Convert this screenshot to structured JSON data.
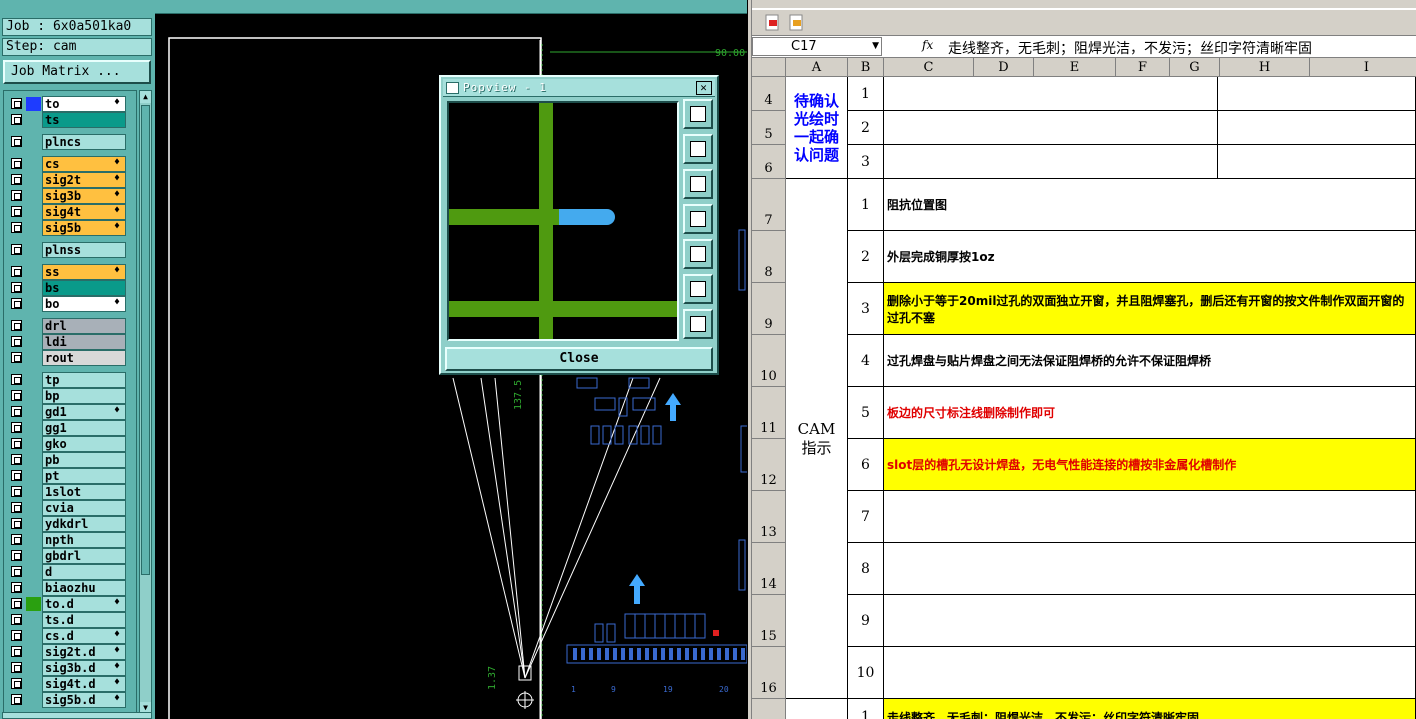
{
  "cam": {
    "job_label": "Job : 6x0a501ka0",
    "step_label": "Step: cam",
    "job_matrix_button": "Job Matrix ...",
    "layers": [
      {
        "name": "to",
        "swatch": "#1e3cff",
        "fill": "#ffffff",
        "flame": true
      },
      {
        "name": "ts",
        "swatch": "",
        "fill": "#0a9a8a",
        "flame": false
      },
      {
        "name": "plncs",
        "swatch": "",
        "fill": "#a6e0dc",
        "flame": false
      },
      {
        "name": "cs",
        "swatch": "",
        "fill": "#ffc040",
        "flame": true
      },
      {
        "name": "sig2t",
        "swatch": "",
        "fill": "#ffc040",
        "flame": true
      },
      {
        "name": "sig3b",
        "swatch": "",
        "fill": "#ffc040",
        "flame": true
      },
      {
        "name": "sig4t",
        "swatch": "",
        "fill": "#ffc040",
        "flame": true
      },
      {
        "name": "sig5b",
        "swatch": "",
        "fill": "#ffc040",
        "flame": true
      },
      {
        "name": "plnss",
        "swatch": "",
        "fill": "#a6e0dc",
        "flame": false
      },
      {
        "name": "ss",
        "swatch": "",
        "fill": "#ffc040",
        "flame": true
      },
      {
        "name": "bs",
        "swatch": "",
        "fill": "#0a9a8a",
        "flame": false
      },
      {
        "name": "bo",
        "swatch": "",
        "fill": "#ffffff",
        "flame": true
      },
      {
        "name": "drl",
        "swatch": "",
        "fill": "#a8b0b8",
        "flame": false
      },
      {
        "name": "ldi",
        "swatch": "",
        "fill": "#a8b0b8",
        "flame": false
      },
      {
        "name": "rout",
        "swatch": "",
        "fill": "#d8d8d8",
        "flame": false
      },
      {
        "name": "tp",
        "swatch": "",
        "fill": "#a6e0dc",
        "flame": false
      },
      {
        "name": "bp",
        "swatch": "",
        "fill": "#a6e0dc",
        "flame": false
      },
      {
        "name": "gd1",
        "swatch": "",
        "fill": "#a6e0dc",
        "flame": true
      },
      {
        "name": "gg1",
        "swatch": "",
        "fill": "#a6e0dc",
        "flame": false
      },
      {
        "name": "gko",
        "swatch": "",
        "fill": "#a6e0dc",
        "flame": false
      },
      {
        "name": "pb",
        "swatch": "",
        "fill": "#a6e0dc",
        "flame": false
      },
      {
        "name": "pt",
        "swatch": "",
        "fill": "#a6e0dc",
        "flame": false
      },
      {
        "name": "1slot",
        "swatch": "",
        "fill": "#a6e0dc",
        "flame": false
      },
      {
        "name": "cvia",
        "swatch": "",
        "fill": "#a6e0dc",
        "flame": false
      },
      {
        "name": "ydkdrl",
        "swatch": "",
        "fill": "#a6e0dc",
        "flame": false
      },
      {
        "name": "npth",
        "swatch": "",
        "fill": "#a6e0dc",
        "flame": false
      },
      {
        "name": "gbdrl",
        "swatch": "",
        "fill": "#a6e0dc",
        "flame": false
      },
      {
        "name": "d",
        "swatch": "",
        "fill": "#a6e0dc",
        "flame": false
      },
      {
        "name": "biaozhu",
        "swatch": "",
        "fill": "#a6e0dc",
        "flame": false
      },
      {
        "name": "to.d",
        "swatch": "#2aa010",
        "fill": "#a6e0dc",
        "flame": true
      },
      {
        "name": "ts.d",
        "swatch": "",
        "fill": "#a6e0dc",
        "flame": false
      },
      {
        "name": "cs.d",
        "swatch": "",
        "fill": "#a6e0dc",
        "flame": true
      },
      {
        "name": "sig2t.d",
        "swatch": "",
        "fill": "#a6e0dc",
        "flame": true
      },
      {
        "name": "sig3b.d",
        "swatch": "",
        "fill": "#a6e0dc",
        "flame": true
      },
      {
        "name": "sig4t.d",
        "swatch": "",
        "fill": "#a6e0dc",
        "flame": true
      },
      {
        "name": "sig5b.d",
        "swatch": "",
        "fill": "#a6e0dc",
        "flame": true
      }
    ],
    "canvas_labels": {
      "dim_top": "90.00",
      "dim_side": "137.5",
      "dim_small": "1.37",
      "tick_labels": [
        "1",
        "9",
        "19",
        "20"
      ]
    }
  },
  "popview": {
    "title": "Popview - 1",
    "close_x": "✕",
    "close_button": "Close"
  },
  "sheet": {
    "name_box": "C17",
    "fx": "fx",
    "formula": "走线整齐，无毛刺；阻焊光洁，不发污；丝印字符清晰牢固",
    "columns": [
      "A",
      "B",
      "C",
      "D",
      "E",
      "F",
      "G",
      "H",
      "I"
    ],
    "pending_label": "待确认光绘时一起确认问题",
    "cam_label": "CAM指示",
    "pending_rows": [
      {
        "row": "4",
        "num": "1"
      },
      {
        "row": "5",
        "num": "2"
      },
      {
        "row": "6",
        "num": "3"
      }
    ],
    "cam_rows": [
      {
        "row": "7",
        "num": "1",
        "text": "阻抗位置图",
        "style": ""
      },
      {
        "row": "8",
        "num": "2",
        "text": "外层完成铜厚按1oz",
        "style": ""
      },
      {
        "row": "9",
        "num": "3",
        "text": "删除小于等于20mil过孔的双面独立开窗，并且阻焊塞孔，删后还有开窗的按文件制作双面开窗的过孔不塞",
        "style": "yellow"
      },
      {
        "row": "10",
        "num": "4",
        "text": "过孔焊盘与贴片焊盘之间无法保证阻焊桥的允许不保证阻焊桥",
        "style": ""
      },
      {
        "row": "11",
        "num": "5",
        "text": "板边的尺寸标注线删除制作即可",
        "style": "red"
      },
      {
        "row": "12",
        "num": "6",
        "text": "slot层的槽孔无设计焊盘，无电气性能连接的槽按非金属化槽制作",
        "style": "red yellow"
      },
      {
        "row": "13",
        "num": "7",
        "text": "",
        "style": ""
      },
      {
        "row": "14",
        "num": "8",
        "text": "",
        "style": ""
      },
      {
        "row": "15",
        "num": "9",
        "text": "",
        "style": ""
      },
      {
        "row": "16",
        "num": "10",
        "text": "",
        "style": ""
      }
    ],
    "last_row": {
      "num": "1",
      "text": "走线整齐，无毛刺；阻焊光洁，不发污；丝印字符清晰牢固"
    }
  }
}
